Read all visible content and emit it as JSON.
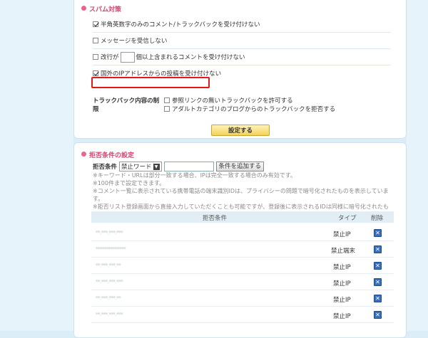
{
  "spam_section": {
    "title": "スパム対策",
    "options": [
      {
        "label": "半角英数字のみのコメント/トラックバックを受け付けない",
        "checked": true
      },
      {
        "label": "メッセージを受信しない",
        "checked": false
      },
      {
        "label_before": "改行が",
        "label_after": "個以上含まれるコメントを受け付けない",
        "value": "",
        "checked": false
      },
      {
        "label": "国外のIPアドレスからの投稿を受け付けない",
        "checked": true
      }
    ],
    "trackback": {
      "label": "トラックバック内容の制限",
      "options": [
        {
          "label": "参照リンクの無いトラックバックを許可する",
          "checked": false
        },
        {
          "label": "アダルトカテゴリのブログからのトラックバックを拒否する",
          "checked": false
        }
      ]
    },
    "submit_label": "設定する"
  },
  "reject_section": {
    "title": "拒否条件の設定",
    "condition_label": "拒否条件",
    "select_value": "禁止ワード",
    "input_value": "",
    "add_button": "条件を追加する",
    "notes": [
      "※キーワード・URLは部分一致する場合、IPは完全一致する場合のみ有効です。",
      "※100件まで設定できます。",
      "※コメント一覧に表示されている携帯電話の端末識別IDは、プライバシーの問題で暗号化されたものを表示しています。",
      "※拒否リスト登録画面から直接入力していただくことも可能ですが、登録後に表示されるIDは同様に暗号化されたものとなりますのでご了承ください。"
    ],
    "table": {
      "headers": {
        "condition": "拒否条件",
        "type": "タイプ",
        "delete": "削除"
      },
      "rows": [
        {
          "value": "**.***.***.***",
          "type": "禁止IP"
        },
        {
          "value": "**************",
          "type": "禁止端末"
        },
        {
          "value": "**.***.***.**",
          "type": "禁止IP"
        },
        {
          "value": "**.***.***.***",
          "type": "禁止IP"
        },
        {
          "value": "**.***.***.**",
          "type": "禁止IP"
        },
        {
          "value": "**.***.***.***",
          "type": "禁止IP"
        }
      ]
    }
  }
}
